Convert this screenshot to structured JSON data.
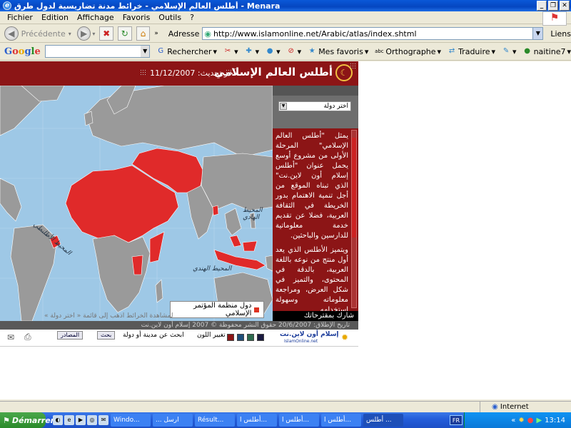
{
  "window": {
    "title": "أطلس العالم الإسلامي - خرائط مدنة تضاريسية لدول طرق - Menara",
    "buttons": [
      "_",
      "❐",
      "✕"
    ]
  },
  "menu": [
    "Fichier",
    "Edition",
    "Affichage",
    "Favoris",
    "Outils",
    "?"
  ],
  "nav": {
    "back_label": "Précédente",
    "address_label": "Adresse",
    "url": "http://www.islamonline.net/Arabic/atlas/index.shtml",
    "links_label": "Liens"
  },
  "google_bar": {
    "logo": [
      "G",
      "o",
      "o",
      "g",
      "l",
      "e"
    ],
    "search_label": "Rechercher",
    "favorites_label": "Mes favoris",
    "spelling_label": "Orthographe",
    "translate_label": "Traduire",
    "user_label": "naitine7"
  },
  "site": {
    "title": "أطلس العالم الإسلامي",
    "last_update": "آخر تحديث: 11/12/2007",
    "country_select": "اختر دولة",
    "description_p1": "يمثل \"أطلس العالم الإسلامي\" المرحلة الأولى من مشروع أوسع يحمل عنوان \"أطلس إسلام أون لاين.نت\" الذي تبناه الموقع من أجل تنمية الاهتمام بدور الخريطة في الثقافة العربية، فضلا عن تقديم خدمة معلوماتية للدارسين والباحثين.",
    "description_p2": "ويتميز الأطلس الذي يعد أول منتج من نوعه باللغة العربية، بالدقة في المحتوى، والتميز في شكل العرض، ومراجعة معلوماته وسهولة استخدامه",
    "share_label": "شارك بمقترحاتك",
    "legend_label": "دول منظمة المؤتمر الإسلامي",
    "map_hint": "لمشاهدة الخرائط اذهب إلى قائمة « اختر دولة »",
    "ocean_labels": [
      "المحيط الهادي",
      "المحيط الهندي",
      "المحيط الأطلنطي"
    ],
    "footer_text": "تاريخ الإطلاق: 20/6/2007     حقوق النشر محفوظة © 2007 إسلام أون لاين.نت",
    "search_city_label": "ابحث عن مدينة أو دولة",
    "search_button": "بحث",
    "sources_button": "المصادر",
    "change_colors_label": "تغيير اللون",
    "brand": "إسلام أون لاين.نت",
    "brand_sub": "IslamOnline.net",
    "color_swatches": [
      "#8c1516",
      "#1f4e79",
      "#2e6b4f",
      "#1a1a40"
    ]
  },
  "status": {
    "zone": "Internet"
  },
  "taskbar": {
    "start_label": "Démarrer",
    "tasks": [
      "Windo...",
      "... ارسل",
      "Résult...",
      "أطلس ا...",
      "أطلس ا...",
      "أطلس ا...",
      "أطلس ..."
    ],
    "lang": "FR",
    "clock": "13:14"
  }
}
